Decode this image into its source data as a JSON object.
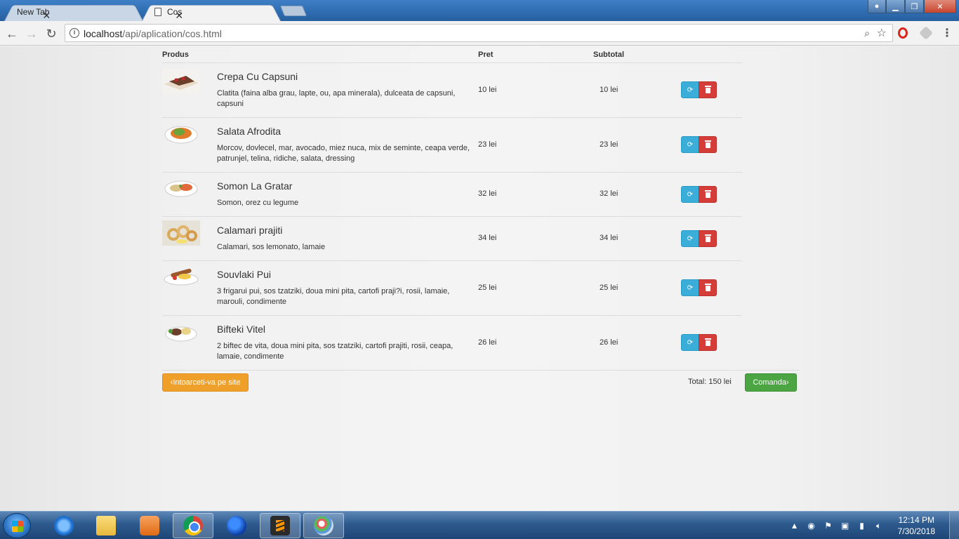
{
  "browser": {
    "tabs": [
      {
        "title": "New Tab",
        "active": false
      },
      {
        "title": "Cos",
        "active": true
      }
    ],
    "url_host": "localhost",
    "url_path": "/api/aplication/cos.html"
  },
  "cart": {
    "headers": {
      "product": "Produs",
      "price": "Pret",
      "subtotal": "Subtotal"
    },
    "items": [
      {
        "name": "Crepa Cu Capsuni",
        "description": "Clatita (faina alba grau, lapte, ou, apa minerala), dulceata de capsuni, capsuni",
        "price": "10 lei",
        "subtotal": "10 lei",
        "image": "crepe-image"
      },
      {
        "name": "Salata Afrodita",
        "description": "Morcov, dovlecel, mar, avocado, miez nuca, mix de seminte, ceapa verde, patrunjel, telina, ridiche, salata, dressing",
        "price": "23 lei",
        "subtotal": "23 lei",
        "image": "salad-image"
      },
      {
        "name": "Somon La Gratar",
        "description": "Somon, orez cu legume",
        "price": "32 lei",
        "subtotal": "32 lei",
        "image": "salmon-image"
      },
      {
        "name": "Calamari prajiti",
        "description": "Calamari, sos lemonato, lamaie",
        "price": "34 lei",
        "subtotal": "34 lei",
        "image": "calamari-image"
      },
      {
        "name": "Souvlaki Pui",
        "description": "3 frigarui pui, sos tzatziki, doua mini pita, cartofi praji?i, rosii, lamaie, marouli, condimente",
        "price": "25 lei",
        "subtotal": "25 lei",
        "image": "souvlaki-image"
      },
      {
        "name": "Bifteki Vitel",
        "description": "2 biftec de vita, doua mini pita, sos tzatziki, cartofi prajiti, rosii, ceapa, lamaie, condimente",
        "price": "26 lei",
        "subtotal": "26 lei",
        "image": "bifteki-image"
      }
    ],
    "back_label": "‹Intoarceti-va pe site",
    "total_label": "Total: 150 lei",
    "order_label": "Comanda›"
  },
  "taskbar": {
    "time": "12:14 PM",
    "date": "7/30/2018"
  },
  "colors": {
    "refresh": "#3aaed8",
    "delete": "#d43d38",
    "back": "#efa02a",
    "order": "#4aa542"
  }
}
